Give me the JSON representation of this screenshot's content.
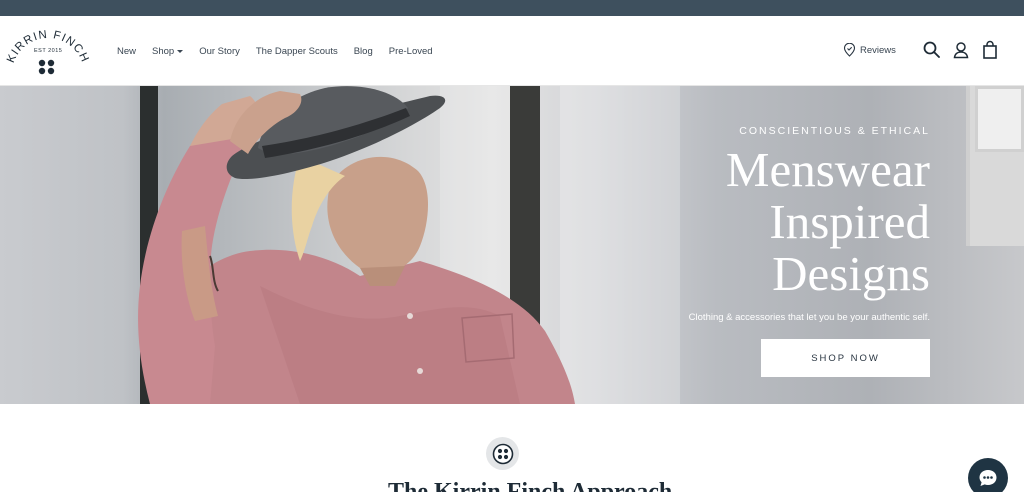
{
  "brand": {
    "name": "KIRRIN FINCH",
    "est": "EST 2015"
  },
  "nav": {
    "items": [
      {
        "label": "New"
      },
      {
        "label": "Shop"
      },
      {
        "label": "Our Story"
      },
      {
        "label": "The Dapper Scouts"
      },
      {
        "label": "Blog"
      },
      {
        "label": "Pre-Loved"
      }
    ]
  },
  "header": {
    "reviews_label": "Reviews",
    "icons": [
      "location-pin-icon",
      "search-icon",
      "account-icon",
      "cart-icon"
    ]
  },
  "hero": {
    "eyebrow": "CONSCIENTIOUS & ETHICAL",
    "headline": [
      "Menswear",
      "Inspired",
      "Designs"
    ],
    "subline": "Clothing & accessories that let you be your authentic self.",
    "cta_label": "SHOP NOW"
  },
  "section": {
    "title": "The Kirrin Finch Approach"
  },
  "colors": {
    "topbar": "#3e505e",
    "text": "#2a3642",
    "chat_button": "#1f3443",
    "cta_bg": "#ffffff"
  }
}
